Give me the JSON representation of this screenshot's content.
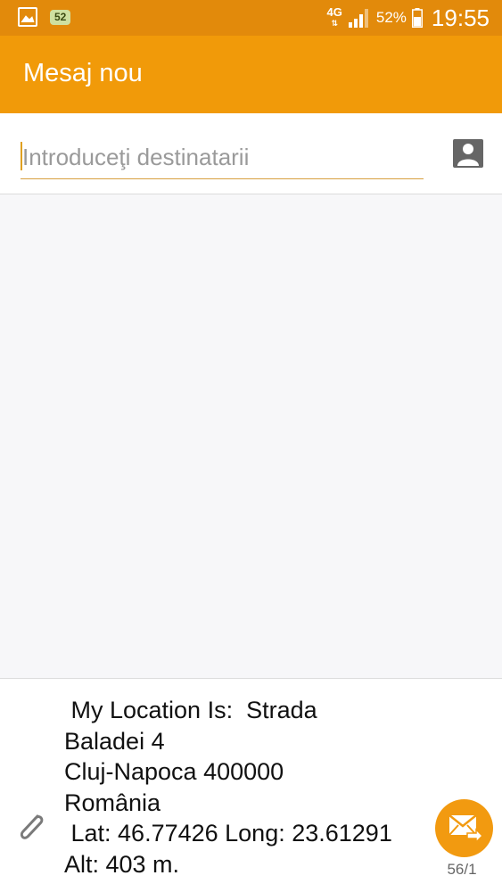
{
  "status_bar": {
    "notification_badge": "52",
    "network_type": "4G",
    "battery_percent": "52%",
    "time": "19:55",
    "icons": [
      "gallery-icon",
      "signal-icon",
      "battery-icon"
    ]
  },
  "app_bar": {
    "title": "Mesaj nou",
    "color": "#f19a09"
  },
  "recipients": {
    "placeholder": "Introduceţi destinatarii",
    "value": "",
    "contact_icon": "contact-icon"
  },
  "composer": {
    "message": " My Location Is:  Strada\nBaladei 4\nCluj-Napoca 400000\nRomânia\n Lat: 46.77426 Long: 23.61291\nAlt: 403 m.",
    "char_count": "56/1",
    "attach_icon": "paperclip-icon",
    "send_icon": "send-mail-icon",
    "send_color": "#f29a10"
  }
}
